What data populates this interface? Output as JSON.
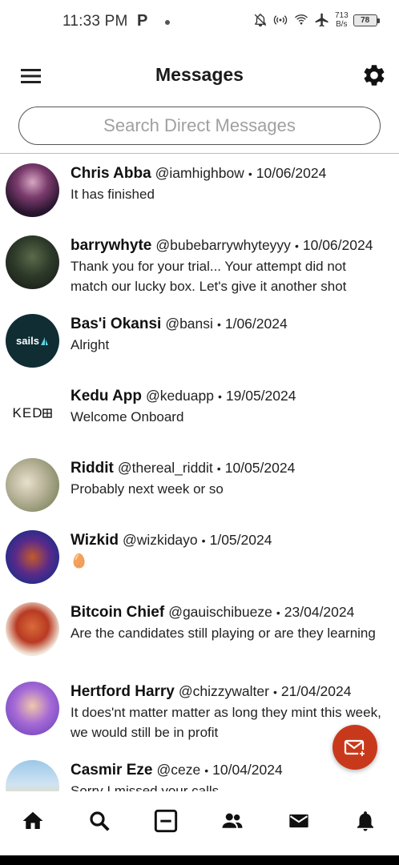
{
  "status_bar": {
    "time": "11:33 PM",
    "carrier_icon": "P",
    "net_speed_value": "713",
    "net_speed_unit": "B/s",
    "battery": "78"
  },
  "header": {
    "title": "Messages",
    "menu_icon": "hamburger-menu-icon",
    "settings_icon": "gear-icon"
  },
  "search": {
    "placeholder": "Search Direct Messages",
    "value": ""
  },
  "conversations": [
    {
      "name": "Chris Abba",
      "handle": "@iamhighbow",
      "date": "10/06/2024",
      "message": "It has finished"
    },
    {
      "name": "barrywhyte",
      "handle": "@bubebarrywhyteyyy",
      "date": "10/06/2024",
      "message": "Thank you for your trial... Your attempt did not match our lucky box. Let's give it another shot"
    },
    {
      "name": "Bas'i Okansi",
      "handle": "@bansi",
      "date": "1/06/2024",
      "message": "Alright",
      "avatar_text": "sails"
    },
    {
      "name": "Kedu App",
      "handle": "@keduapp",
      "date": "19/05/2024",
      "message": "Welcome Onboard",
      "avatar_text": "KED"
    },
    {
      "name": "Riddit",
      "handle": "@thereal_riddit",
      "date": "10/05/2024",
      "message": "Probably next week or so"
    },
    {
      "name": "Wizkid",
      "handle": "@wizkidayo",
      "date": "1/05/2024",
      "message": "🥚"
    },
    {
      "name": "Bitcoin Chief",
      "handle": "@gauischibueze",
      "date": "23/04/2024",
      "message": "Are the candidates still playing or are they learning"
    },
    {
      "name": "Hertford Harry",
      "handle": "@chizzywalter",
      "date": "21/04/2024",
      "message": "It does'nt matter matter as long they mint this week, we would still be in profit"
    },
    {
      "name": "Casmir Eze",
      "handle": "@ceze",
      "date": "10/04/2024",
      "message": "Sorry I missed your calls"
    }
  ],
  "separator": "•",
  "bottom_nav": [
    {
      "icon": "home-icon"
    },
    {
      "icon": "search-icon"
    },
    {
      "icon": "minus-box-icon"
    },
    {
      "icon": "people-icon"
    },
    {
      "icon": "mail-icon"
    },
    {
      "icon": "bell-icon"
    }
  ],
  "fab": {
    "icon": "new-message-icon"
  },
  "colors": {
    "accent": "#c8391c",
    "background": "#ffffff"
  }
}
